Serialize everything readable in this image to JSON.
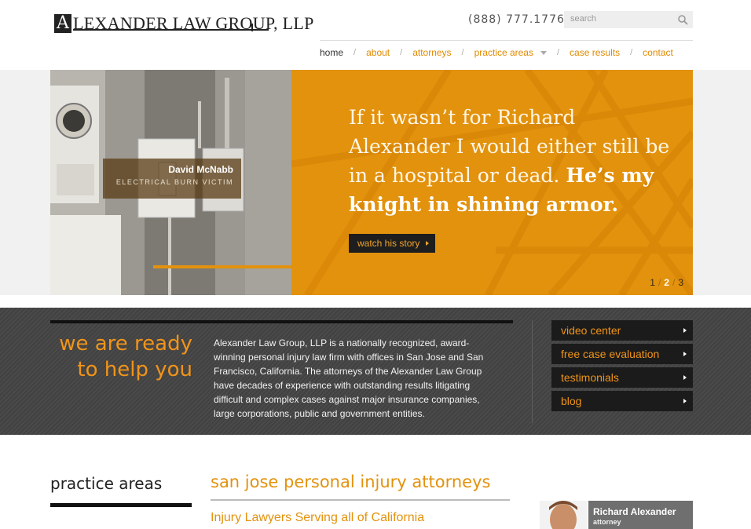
{
  "header": {
    "logo_initial": "A",
    "logo_text": "LEXANDER LAW GROUP, LLP",
    "phone": "(888) 777.1776",
    "search_placeholder": "search"
  },
  "nav": {
    "items": [
      {
        "label": "home",
        "active": true
      },
      {
        "label": "about"
      },
      {
        "label": "attorneys"
      },
      {
        "label": "practice areas",
        "dropdown": true
      },
      {
        "label": "case results"
      },
      {
        "label": "contact"
      }
    ],
    "separator": "/"
  },
  "hero": {
    "quote_part1": "If it wasn’t for Richard Alexander I would either still be in a hospital or dead.",
    "quote_part2": "He’s my knight in shining armor.",
    "button_label": "watch his story",
    "caption_name": "David McNabb",
    "caption_role": "ELECTRICAL BURN VICTIM",
    "pager": {
      "p1": "1",
      "p2": "2",
      "p3": "3",
      "sep": "/"
    }
  },
  "band": {
    "title_line1": "we are ready",
    "title_line2": "to help you",
    "text": "Alexander Law Group, LLP is a nationally recognized, award-winning personal injury law firm with offices in San Jose and San Francisco, California. The attorneys of the Alexander Law Group have decades of experience with outstanding results litigating difficult and complex cases against major insurance companies, large corporations, public and government entities.",
    "links": [
      "video center",
      "free case evaluation",
      "testimonials",
      "blog"
    ]
  },
  "lower": {
    "practice_title": "practice areas",
    "main_title": "san jose personal injury attorneys",
    "main_subtitle": "Injury Lawyers Serving all of California",
    "attorney_name": "Richard Alexander",
    "attorney_role": "attorney"
  },
  "colors": {
    "accent": "#e3920d",
    "dark_band": "#444444"
  }
}
